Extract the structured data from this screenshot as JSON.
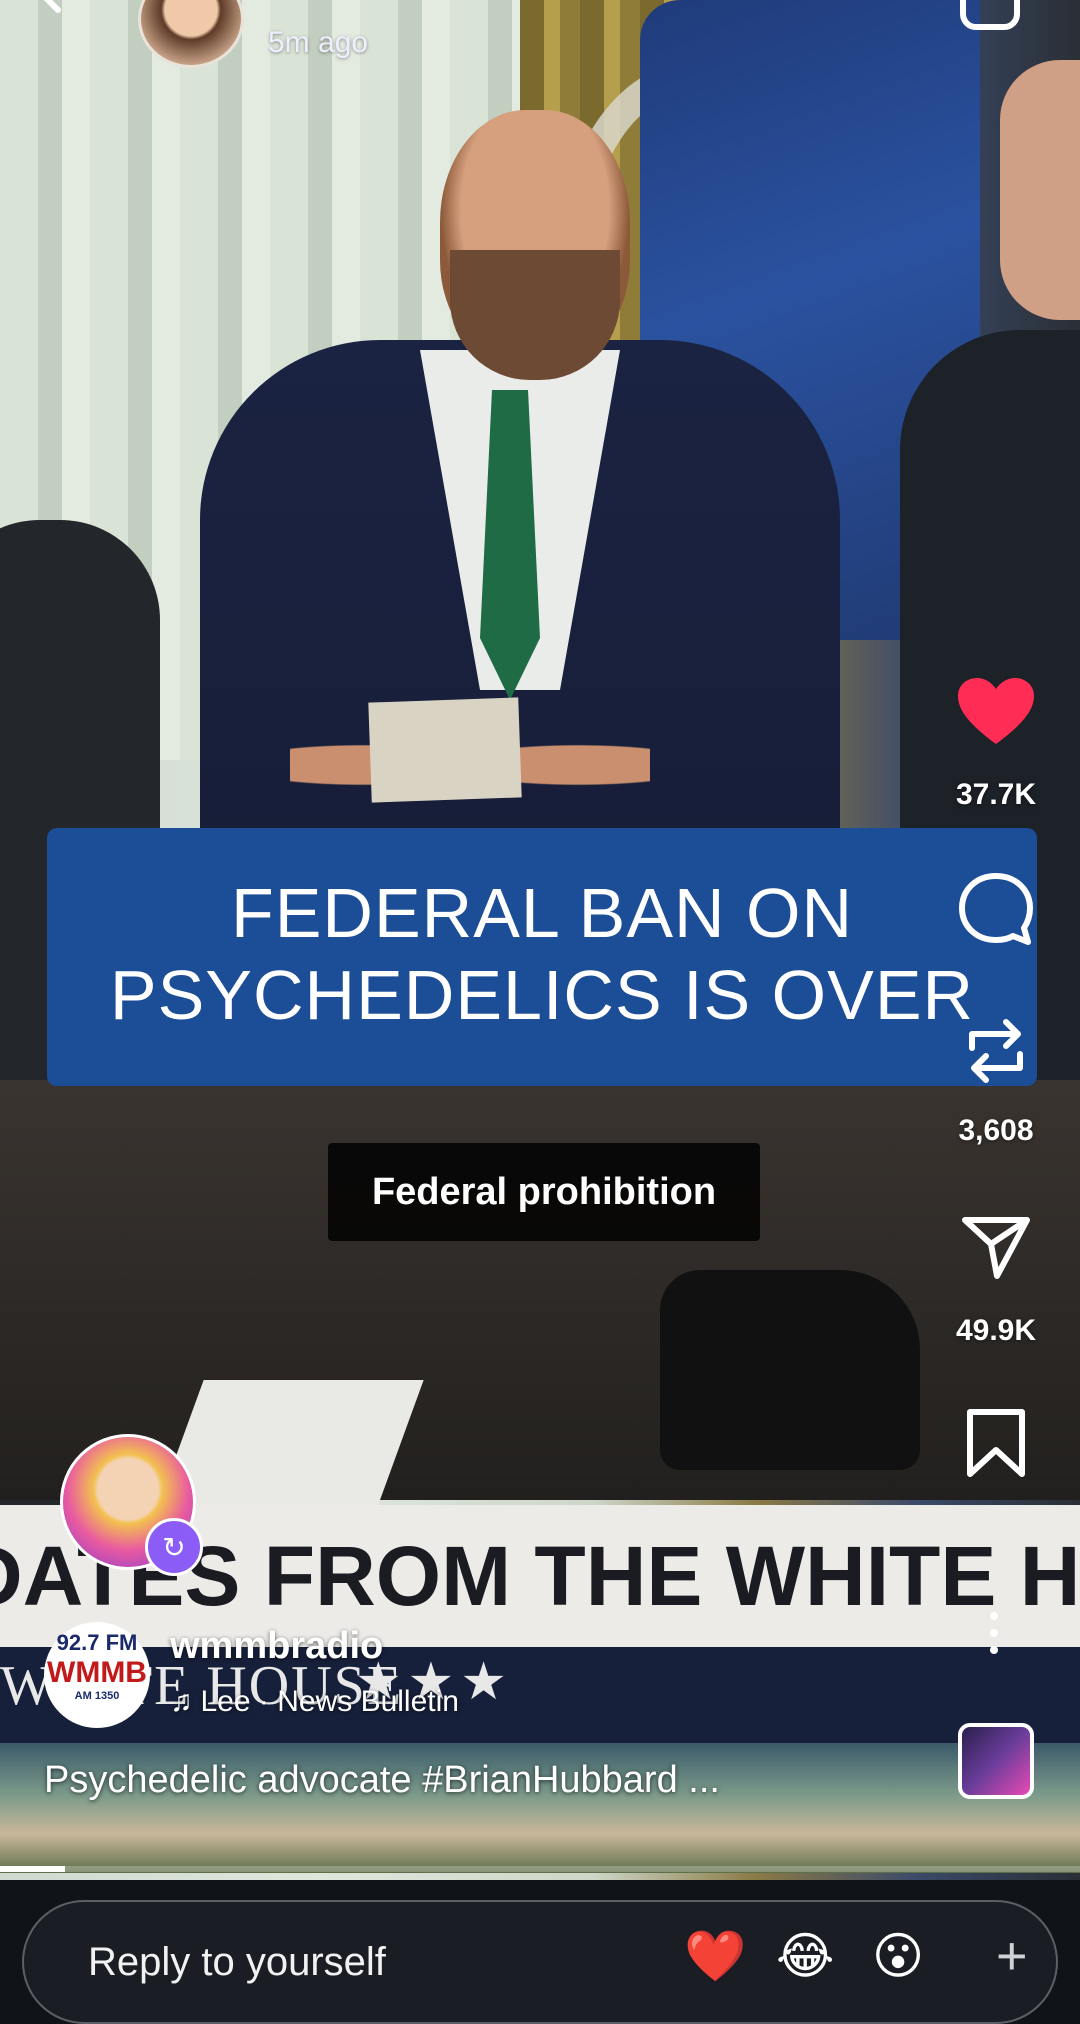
{
  "header": {
    "time_ago": "5m ago"
  },
  "video": {
    "banner_line1": "FEDERAL BAN ON",
    "banner_line2": "PSYCHEDELICS IS OVER",
    "caption": "Federal prohibition",
    "lower_third": "DATES FROM THE WHITE H",
    "lower_bar_text": "WHITE HOUSE",
    "lower_bar_stars": "★★★"
  },
  "actions": {
    "likes": "37.7K",
    "reposts": "3,608",
    "shares": "49.9K",
    "like_color": "#ff2d55"
  },
  "creator": {
    "username": "wmmbradio",
    "music_note": "♫",
    "music": "Lee · News Bulletin",
    "description": "Psychedelic advocate #BrianHubbard ...",
    "station": {
      "freq": "92.7 FM",
      "call": "WMMB",
      "sub": "AM 1350"
    }
  },
  "playback": {
    "progress": 0.06
  },
  "reply": {
    "placeholder": "Reply to yourself",
    "reactions": [
      "❤️",
      "😂",
      "😮"
    ],
    "add": "+"
  }
}
